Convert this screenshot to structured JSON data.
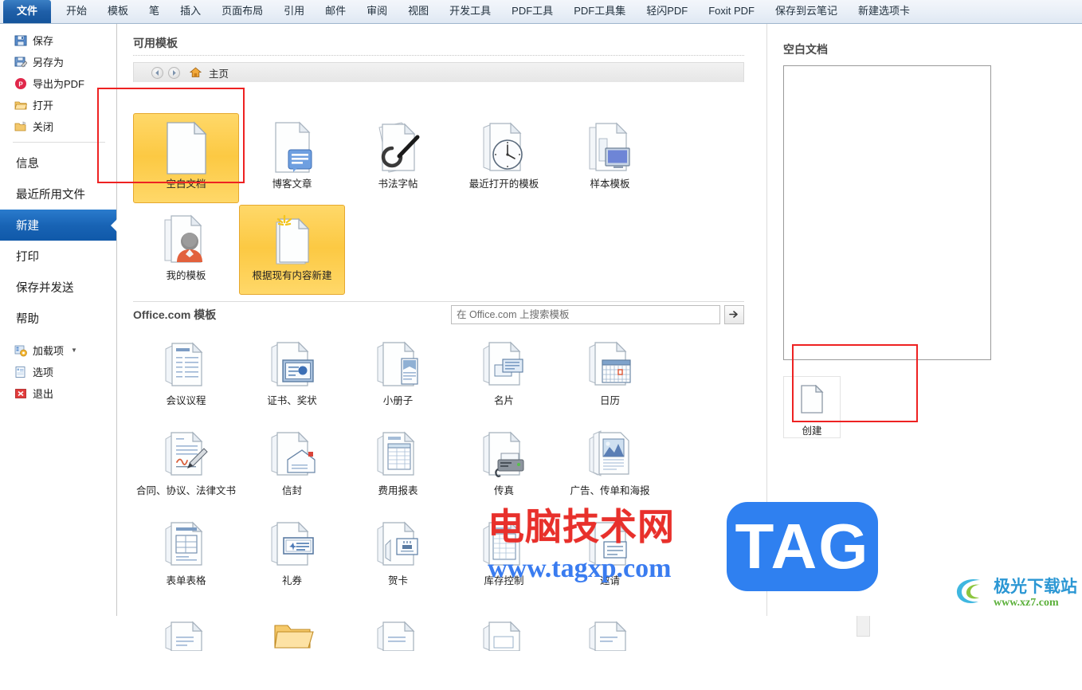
{
  "ribbon": {
    "file_tab": "文件",
    "tabs": [
      "开始",
      "模板",
      "笔",
      "插入",
      "页面布局",
      "引用",
      "邮件",
      "审阅",
      "视图",
      "开发工具",
      "PDF工具",
      "PDF工具集",
      "轻闪PDF",
      "Foxit PDF",
      "保存到云笔记",
      "新建选项卡"
    ]
  },
  "backstage": {
    "commands": [
      {
        "label": "保存",
        "icon": "save-icon"
      },
      {
        "label": "另存为",
        "icon": "save-as-icon"
      },
      {
        "label": "导出为PDF",
        "icon": "export-pdf-icon"
      },
      {
        "label": "打开",
        "icon": "open-folder-icon"
      },
      {
        "label": "关闭",
        "icon": "close-folder-icon"
      }
    ],
    "sections": [
      {
        "label": "信息"
      },
      {
        "label": "最近所用文件"
      },
      {
        "label": "新建",
        "selected": true
      },
      {
        "label": "打印"
      },
      {
        "label": "保存并发送"
      },
      {
        "label": "帮助"
      }
    ],
    "bottom": [
      {
        "label": "加载项",
        "icon": "addins-icon",
        "has_caret": true
      },
      {
        "label": "选项",
        "icon": "options-icon"
      },
      {
        "label": "退出",
        "icon": "exit-icon"
      }
    ]
  },
  "main": {
    "available_title": "可用模板",
    "breadcrumb": {
      "home_label": "主页",
      "back_icon": "arrow-left-icon",
      "forward_icon": "arrow-right-icon",
      "home_icon": "home-icon"
    },
    "local_templates": [
      {
        "label": "空白文档",
        "icon": "blank-document-icon",
        "highlighted": true
      },
      {
        "label": "博客文章",
        "icon": "blog-post-icon",
        "highlighted": false
      },
      {
        "label": "书法字帖",
        "icon": "calligraphy-icon",
        "highlighted": false
      },
      {
        "label": "最近打开的模板",
        "icon": "recent-templates-icon",
        "highlighted": false
      },
      {
        "label": "样本模板",
        "icon": "sample-templates-icon",
        "highlighted": false
      },
      {
        "label": "我的模板",
        "icon": "my-templates-icon",
        "highlighted": false
      },
      {
        "label": "根据现有内容新建",
        "icon": "new-from-existing-icon",
        "highlighted": true
      }
    ],
    "office_section": {
      "title": "Office.com 模板",
      "search_placeholder": "在 Office.com 上搜索模板",
      "search_value": "",
      "go_icon": "arrow-right-icon"
    },
    "office_templates": [
      {
        "label": "会议议程",
        "icon": "agenda-icon"
      },
      {
        "label": "证书、奖状",
        "icon": "certificate-icon"
      },
      {
        "label": "小册子",
        "icon": "brochure-icon"
      },
      {
        "label": "名片",
        "icon": "business-card-icon"
      },
      {
        "label": "日历",
        "icon": "calendar-icon"
      },
      {
        "label": "合同、协议、法律文书",
        "icon": "contract-icon"
      },
      {
        "label": "信封",
        "icon": "envelope-icon"
      },
      {
        "label": "费用报表",
        "icon": "expense-report-icon"
      },
      {
        "label": "传真",
        "icon": "fax-icon"
      },
      {
        "label": "广告、传单和海报",
        "icon": "flyer-icon"
      },
      {
        "label": "表单表格",
        "icon": "form-icon"
      },
      {
        "label": "礼券",
        "icon": "gift-certificate-icon"
      },
      {
        "label": "贺卡",
        "icon": "greeting-card-icon"
      },
      {
        "label": "库存控制",
        "icon": "inventory-icon"
      },
      {
        "label": "邀请",
        "icon": "invitation-icon"
      }
    ]
  },
  "preview": {
    "title": "空白文档",
    "create_label": "创建",
    "create_icon": "document-icon"
  },
  "watermarks": {
    "site_cn": "电脑技术网",
    "site_url": "www.tagxp.com",
    "tag_logo": "TAG",
    "jg_cn": "极光下载站",
    "jg_url": "www.xz7.com"
  },
  "colors": {
    "accent_blue": "#1863b4",
    "highlight_yellow": "#fcc943",
    "annotation_red": "#ee2222",
    "watermark_red": "#e8302b",
    "watermark_blue": "#3a7cf0",
    "tag_blue": "#2f80f0"
  }
}
